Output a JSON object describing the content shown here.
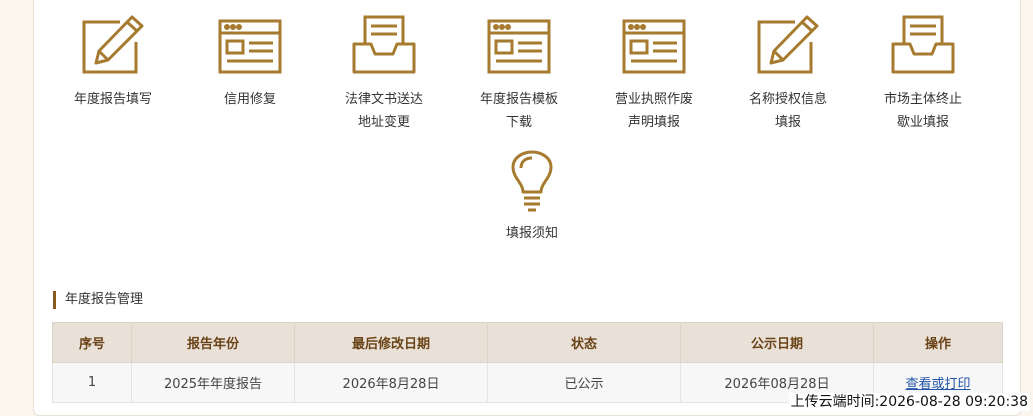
{
  "accent_color": "#a67a2f",
  "tiles": [
    {
      "label": "年度报告填写",
      "icon": "edit-form-icon"
    },
    {
      "label": "信用修复",
      "icon": "browser-window-icon"
    },
    {
      "label": "法律文书送达\n地址变更",
      "icon": "inbox-tray-icon"
    },
    {
      "label": "年度报告模板\n下载",
      "icon": "browser-window-icon"
    },
    {
      "label": "营业执照作废\n声明填报",
      "icon": "browser-window-icon"
    },
    {
      "label": "名称授权信息\n填报",
      "icon": "edit-form-icon"
    },
    {
      "label": "市场主体终止\n歇业填报",
      "icon": "inbox-tray-icon"
    },
    {
      "label": "填报须知",
      "icon": "lightbulb-icon"
    }
  ],
  "section": {
    "title": "年度报告管理"
  },
  "table": {
    "headers": [
      "序号",
      "报告年份",
      "最后修改日期",
      "状态",
      "公示日期",
      "操作"
    ],
    "rows": [
      {
        "index": "1",
        "year": "2025年年度报告",
        "modified": "2026年8月28日",
        "status": "已公示",
        "publish_date": "2026年08月28日",
        "action": "查看或打印"
      }
    ]
  },
  "footer": {
    "upload_time": "上传云端时间:2026-08-28 09:20:38"
  }
}
